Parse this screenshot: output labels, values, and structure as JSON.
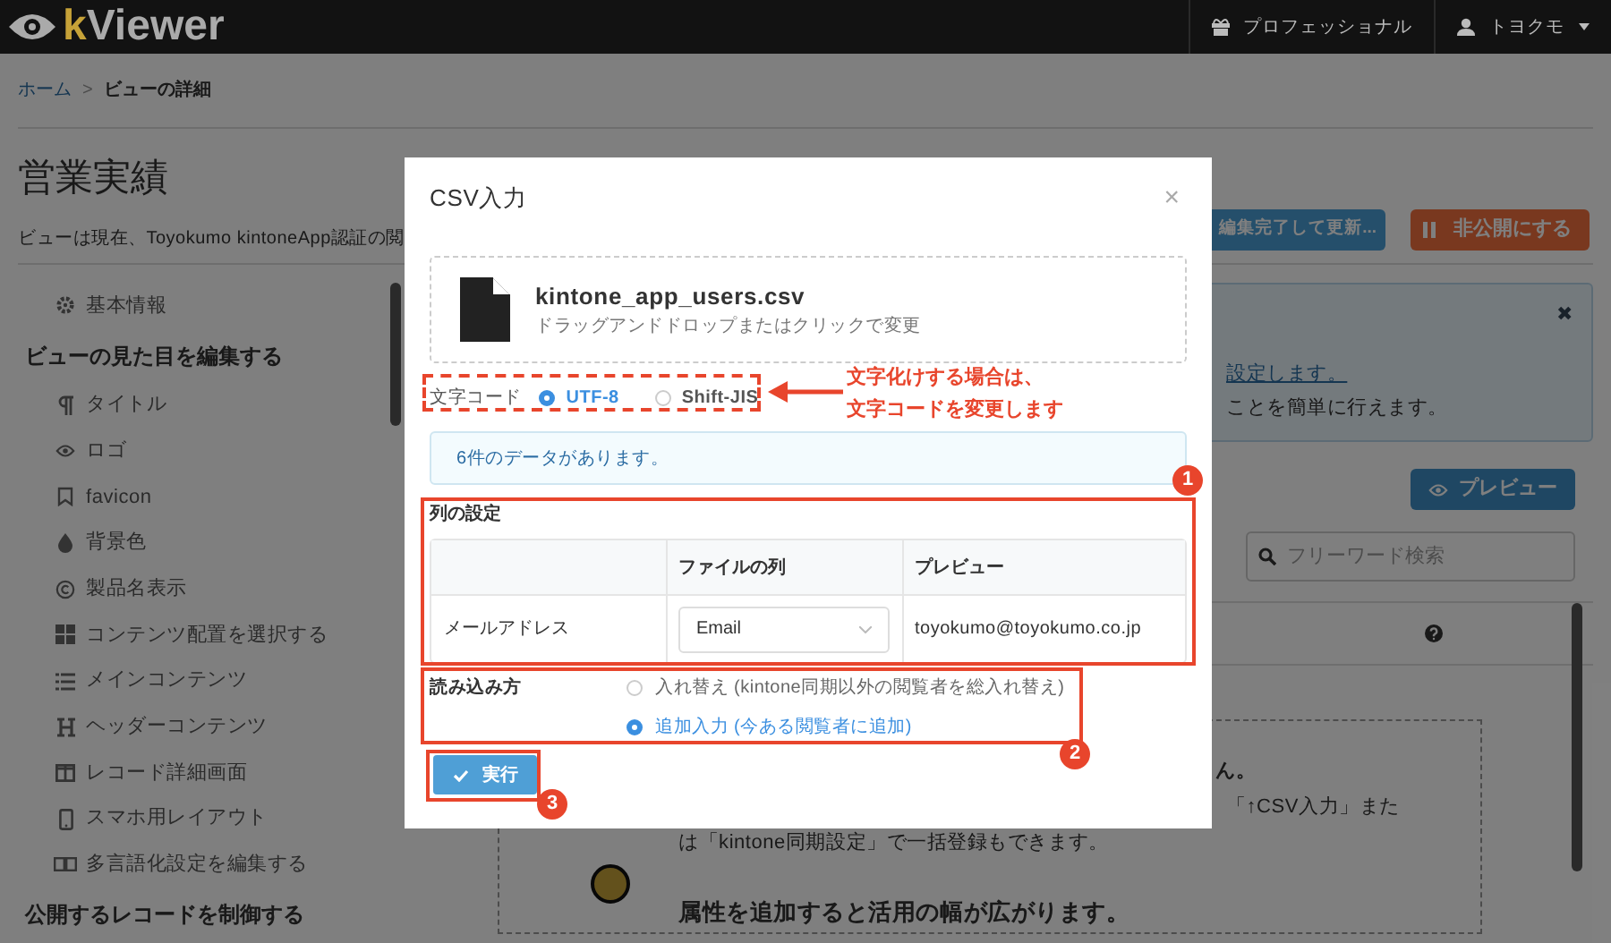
{
  "header": {
    "logo_prefix": "k",
    "logo_rest": "Viewer",
    "plan": "プロフェッショナル",
    "user": "トヨクモ"
  },
  "breadcrumb": {
    "home": "ホーム",
    "separator": ">",
    "current": "ビューの詳細"
  },
  "page_title": "営業実績",
  "description": "ビューは現在、Toyokumo kintoneApp認証の閲",
  "actions": [
    {
      "label": "編集完了して更新...",
      "kind": "primary"
    },
    {
      "label": "非公開にする",
      "kind": "danger"
    }
  ],
  "sidebar": {
    "items": [
      {
        "label": "基本情報",
        "kind": "link"
      },
      {
        "label": "ビューの見た目を編集する",
        "kind": "heading"
      },
      {
        "label": "タイトル",
        "kind": "link"
      },
      {
        "label": "ロゴ",
        "kind": "link"
      },
      {
        "label": "favicon",
        "kind": "link"
      },
      {
        "label": "背景色",
        "kind": "link"
      },
      {
        "label": "製品名表示",
        "kind": "link"
      },
      {
        "label": "コンテンツ配置を選択する",
        "kind": "link"
      },
      {
        "label": "メインコンテンツ",
        "kind": "link"
      },
      {
        "label": "ヘッダーコンテンツ",
        "kind": "link"
      },
      {
        "label": "レコード詳細画面",
        "kind": "link"
      },
      {
        "label": "スマホ用レイアウト",
        "kind": "link"
      },
      {
        "label": "多言語化設定を編集する",
        "kind": "link"
      },
      {
        "label": "公開するレコードを制御する",
        "kind": "heading"
      }
    ]
  },
  "notice": {
    "link": "設定します。",
    "text": "ことを簡単に行えます。",
    "close": "✖"
  },
  "preview_button": "プレビュー",
  "search": {
    "placeholder": "フリーワード検索"
  },
  "empty_panel": {
    "lines": [
      "ん。",
      "「↑CSV入力」また",
      "は「kintone同期設定」で一括登録もできます。"
    ],
    "heading": "属性を追加すると活用の幅が広がります。"
  },
  "modal": {
    "title": "CSV入力",
    "close": "×",
    "file": {
      "name": "kintone_app_users.csv",
      "hint": "ドラッグアンドドロップまたはクリックで変更"
    },
    "encoding": {
      "label": "文字コード",
      "options": [
        {
          "label": "UTF-8",
          "selected": true
        },
        {
          "label": "Shift-JIS",
          "selected": false
        }
      ]
    },
    "info": "6件のデータがあります。",
    "columns_section": {
      "title": "列の設定",
      "columns": [
        "ファイルの列",
        "プレビュー"
      ],
      "rows": [
        {
          "field": "メールアドレス",
          "file_column": "Email",
          "preview": "toyokumo@toyokumo.co.jp"
        }
      ]
    },
    "import_mode": {
      "title": "読み込み方",
      "options": [
        {
          "label": "入れ替え (kintone同期以外の閲覧者を総入れ替え)",
          "selected": false
        },
        {
          "label": "追加入力 (今ある閲覧者に追加)",
          "selected": true
        }
      ]
    },
    "submit": "実行"
  },
  "annotations": {
    "note": [
      "文字化けする場合は、",
      "文字コードを変更します"
    ],
    "badges": [
      "1",
      "2",
      "3"
    ]
  }
}
